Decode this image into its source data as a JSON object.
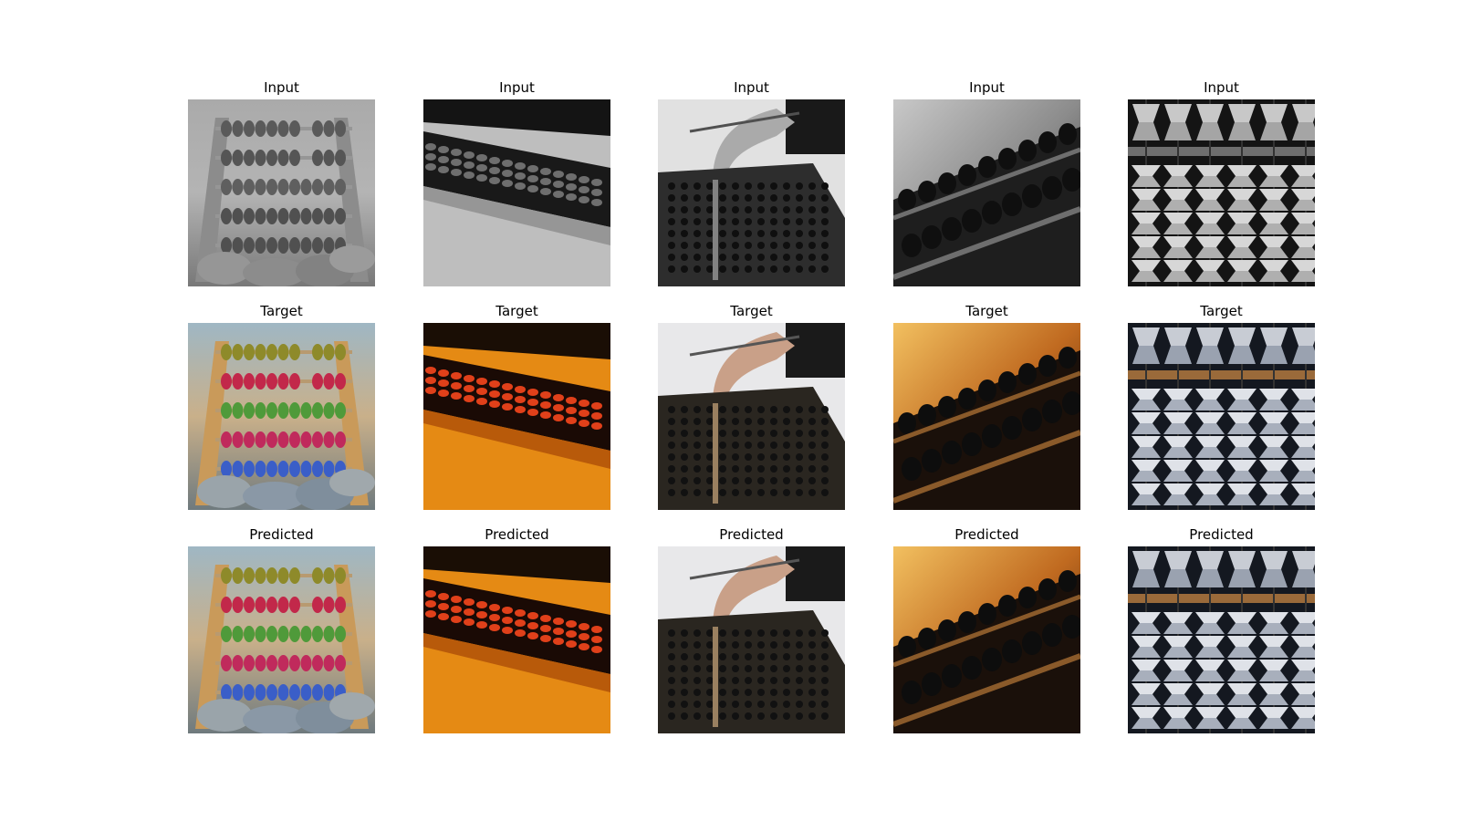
{
  "figure": {
    "rows": [
      {
        "label": "Input",
        "mode": "gray"
      },
      {
        "label": "Target",
        "mode": "color"
      },
      {
        "label": "Predicted",
        "mode": "color"
      }
    ],
    "columns": [
      {
        "scene": "abacus-on-stones"
      },
      {
        "scene": "abacus-on-orange-table"
      },
      {
        "scene": "hand-with-pen-on-abacus"
      },
      {
        "scene": "blurred-abacus-warm-light"
      },
      {
        "scene": "abacus-porcelain-beads"
      }
    ]
  }
}
